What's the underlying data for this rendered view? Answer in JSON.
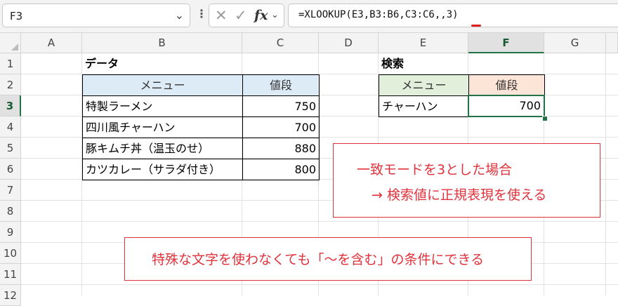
{
  "formula_bar": {
    "name_box": "F3",
    "more": "⋮",
    "cancel_icon": "✕",
    "enter_icon": "✓",
    "fx": "fx",
    "formula": "=XLOOKUP(E3,B3:B6,C3:C6,,3)"
  },
  "columns": [
    "A",
    "B",
    "C",
    "D",
    "E",
    "F",
    "G"
  ],
  "rows": [
    "1",
    "2",
    "3",
    "4",
    "5",
    "6",
    "7",
    "8",
    "9",
    "10",
    "11",
    "12"
  ],
  "selection": {
    "column": "F",
    "row": "3"
  },
  "data_table": {
    "title": "データ",
    "headers": [
      "メニュー",
      "値段"
    ],
    "rows": [
      {
        "menu": "特製ラーメン",
        "price": "750"
      },
      {
        "menu": "四川風チャーハン",
        "price": "700"
      },
      {
        "menu": "豚キムチ丼（温玉のせ）",
        "price": "880"
      },
      {
        "menu": "カツカレー（サラダ付き）",
        "price": "800"
      }
    ]
  },
  "search_table": {
    "title": "検索",
    "headers": [
      "メニュー",
      "値段"
    ],
    "menu": "チャーハン",
    "price": "700"
  },
  "callouts": {
    "mode_line1": "一致モードを3とした場合",
    "mode_line2": "→ 検索値に正規表現を使える",
    "note": "特殊な文字を使わなくても「～を含む」の条件にできる"
  },
  "colors": {
    "accent_green": "#217346",
    "callout_red": "#e0323c",
    "header_blue": "#ddebf7",
    "header_green": "#e2efda",
    "header_orange": "#fce4d6"
  }
}
